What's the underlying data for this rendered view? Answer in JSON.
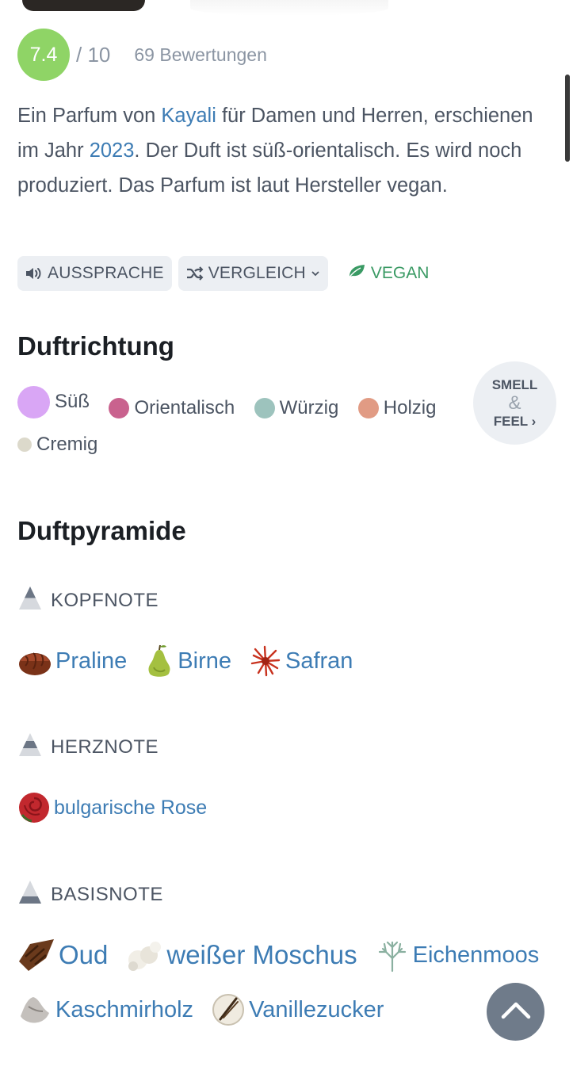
{
  "rating": {
    "score": "7.4",
    "max": "/ 10",
    "count": "69 Bewertungen"
  },
  "description": {
    "part1": "Ein Parfum von ",
    "brand": "Kayali",
    "part2": " für Damen und Herren, erschienen im Jahr ",
    "year": "2023",
    "part3": ". Der Duft ist süß-orientalisch. Es wird noch produziert. Das Parfum ist laut Hersteller vegan."
  },
  "chips": {
    "pronunciation": "AUSSPRACHE",
    "compare": "VERGLEICH",
    "vegan": "VEGAN"
  },
  "scent_direction": {
    "title": "Duftrichtung",
    "accords": [
      {
        "label": "Süß",
        "color": "#d9a6f5"
      },
      {
        "label": "Orientalisch",
        "color": "#c9628e"
      },
      {
        "label": "Würzig",
        "color": "#9dc3bd"
      },
      {
        "label": "Holzig",
        "color": "#e19b84"
      },
      {
        "label": "Cremig",
        "color": "#dcd9cb"
      }
    ],
    "smell_feel": {
      "line1": "SMELL",
      "amp": "&",
      "line2": "FEEL ›"
    }
  },
  "pyramid": {
    "title": "Duftpyramide",
    "top": {
      "label": "KOPFNOTE",
      "notes": [
        {
          "name": "Praline",
          "icon": "praline-icon"
        },
        {
          "name": "Birne",
          "icon": "pear-icon"
        },
        {
          "name": "Safran",
          "icon": "saffron-icon"
        }
      ]
    },
    "heart": {
      "label": "HERZNOTE",
      "notes": [
        {
          "name": "bulgarische Rose",
          "icon": "rose-icon"
        }
      ]
    },
    "base": {
      "label": "BASISNOTE",
      "notes": [
        {
          "name": "Oud",
          "icon": "oud-icon"
        },
        {
          "name": "weißer Moschus",
          "icon": "white-musk-icon"
        },
        {
          "name": "Eichenmoos",
          "icon": "oakmoss-icon"
        },
        {
          "name": "Kaschmirholz",
          "icon": "cashmere-wood-icon"
        },
        {
          "name": "Vanillezucker",
          "icon": "vanilla-sugar-icon"
        }
      ]
    }
  },
  "colors": {
    "link": "#3d7cb4",
    "rating_badge": "#8fd466",
    "vegan": "#3a9a64"
  }
}
